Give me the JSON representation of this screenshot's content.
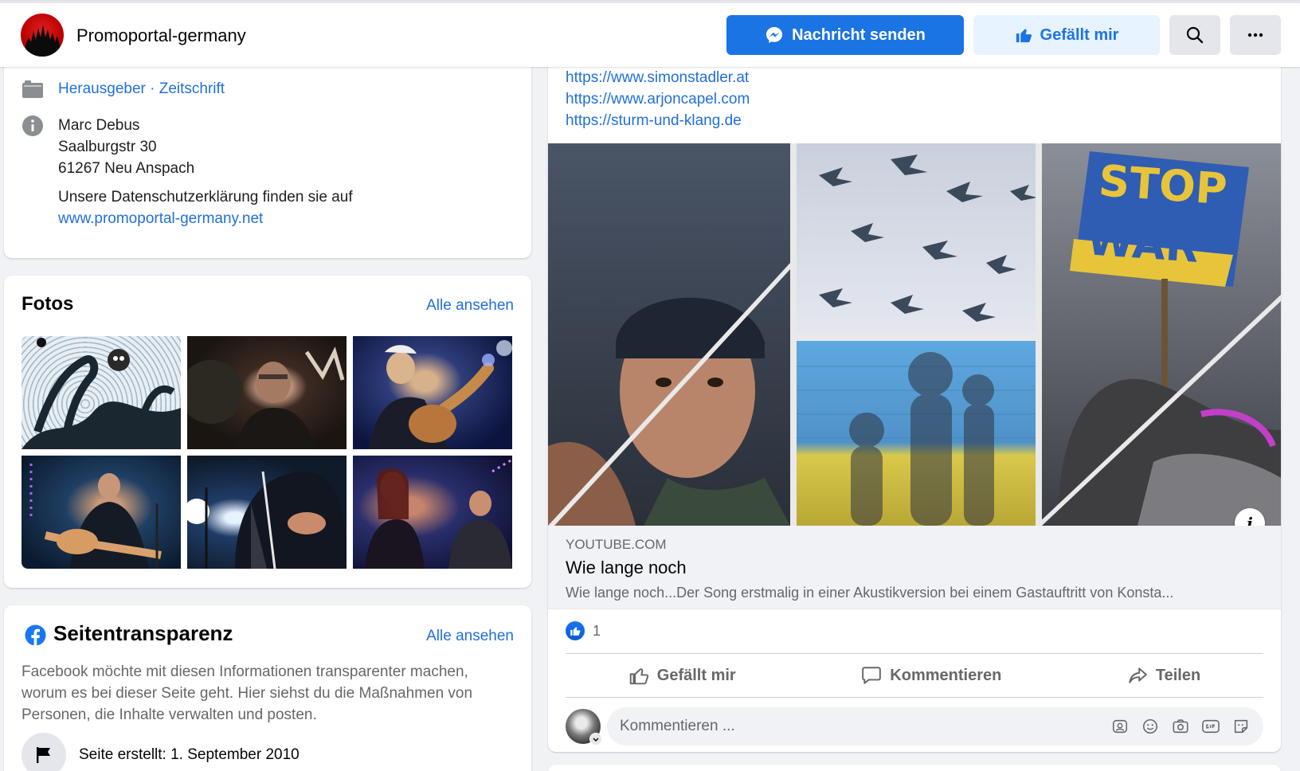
{
  "header": {
    "page_name": "Promoportal-germany",
    "message_button": "Nachricht senden",
    "like_button": "Gefällt mir"
  },
  "info": {
    "category_1": "Herausgeber",
    "separator": " · ",
    "category_2": "Zeitschrift",
    "address_name": "Marc Debus",
    "address_street": "Saalburgstr 30",
    "address_city": "61267 Neu Anspach",
    "privacy_text": "Unsere Datenschutzerklärung finden sie auf",
    "privacy_link": "www.promoportal-germany.net"
  },
  "photos": {
    "title": "Fotos",
    "see_all": "Alle ansehen"
  },
  "transparency": {
    "title": "Seitentransparenz",
    "see_all": "Alle ansehen",
    "description": "Facebook möchte mit diesen Informationen transparenter machen, worum es bei dieser Seite geht. Hier siehst du die Maßnahmen von Personen, die Inhalte verwalten und posten.",
    "created": "Seite erstellt: 1. September 2010"
  },
  "post": {
    "links": [
      "https://www.simonstadler.at",
      "https://www.arjoncapel.com",
      "https://sturm-und-klang.de"
    ],
    "image_sign_line1": "STOP",
    "image_sign_line2": "WAR",
    "preview_domain": "YOUTUBE.COM",
    "preview_title": "Wie lange noch",
    "preview_description": "Wie lange noch...Der Song erstmalig in einer Akustikversion bei einem Gastauftritt von Konsta...",
    "like_count": "1",
    "action_like": "Gefällt mir",
    "action_comment": "Kommentieren",
    "action_share": "Teilen",
    "comment_placeholder": "Kommentieren ..."
  },
  "colors": {
    "accent": "#1b74e4",
    "link": "#216fdb",
    "background": "#f0f2f5"
  }
}
